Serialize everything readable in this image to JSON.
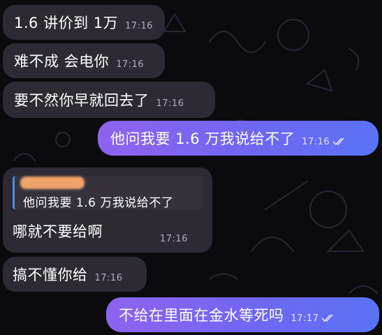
{
  "messages": [
    {
      "text": "1.6 讲价到 1万",
      "time": "17:16"
    },
    {
      "text": "难不成 会电你",
      "time": "17:16"
    },
    {
      "text": "要不然你早就回去了",
      "time": "17:16"
    },
    {
      "text": "他问我要 1.6 万我说给不了",
      "time": "17:16",
      "read": true
    },
    {
      "reply_quote": "他问我要 1.6 万我说给不了",
      "text": "哪就不要给啊",
      "time": "17:16"
    },
    {
      "text": "搞不懂你给",
      "time": "17:16"
    },
    {
      "text": "不给在里面在金水等死吗",
      "time": "17:17",
      "read": true
    }
  ],
  "colors": {
    "incoming_bubble": "#2e2a33",
    "outgoing_gradient_start": "#8e63ee",
    "outgoing_gradient_end": "#5a72f5",
    "reply_bar": "#4a90e2",
    "background": "#0b0b0e"
  },
  "icons": {
    "read_receipt": "double-check-icon",
    "redacted_name": "blurred-name"
  }
}
